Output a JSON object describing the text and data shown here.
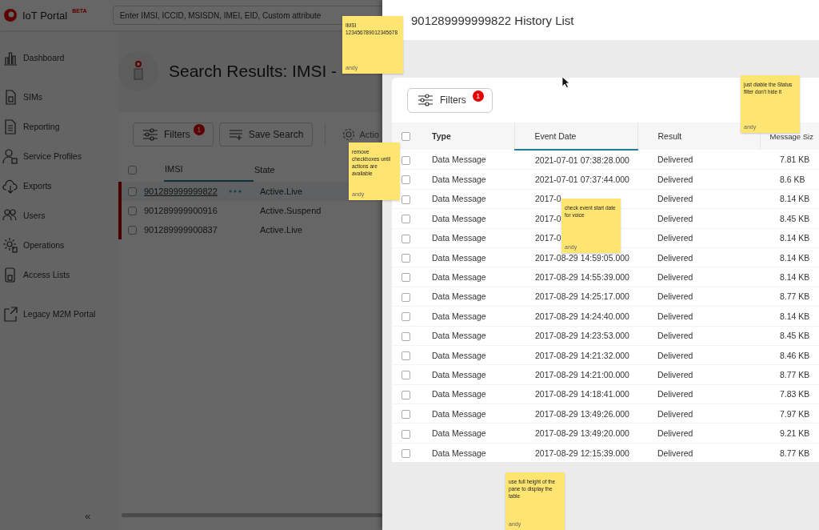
{
  "header": {
    "logo": "IoT Portal",
    "badge": "BETA",
    "search_placeholder": "Enter IMSI, ICCID, MSISDN, IMEI, EID, Custom attribute"
  },
  "sidebar": {
    "items": [
      {
        "label": "Dashboard",
        "kind": "chart"
      },
      {
        "label": "SIMs",
        "kind": "sim"
      },
      {
        "label": "Reporting",
        "kind": "doc"
      },
      {
        "label": "Service Profiles",
        "kind": "person"
      },
      {
        "label": "Exports",
        "kind": "cloud"
      },
      {
        "label": "Users",
        "kind": "users"
      },
      {
        "label": "Operations",
        "kind": "gear"
      },
      {
        "label": "Access Lists",
        "kind": "card"
      }
    ],
    "links": [
      {
        "label": "Legacy M2M Portal",
        "kind": "external"
      }
    ],
    "collapse": "«"
  },
  "page": {
    "title": "Search Results: IMSI -",
    "toolbar": {
      "filters": "Filters",
      "filter_count": "1",
      "save": "Save Search",
      "actions": "Actio"
    },
    "table": {
      "columns": [
        {
          "label": "IMSI",
          "sorted": true
        },
        {
          "label": "State",
          "sorted": false
        }
      ],
      "select_all": false,
      "rows": [
        {
          "imsi": "901289999999822",
          "state": "Active.Live",
          "selected": true,
          "checked": false
        },
        {
          "imsi": "901289999900916",
          "state": "Active.Suspend",
          "selected": false,
          "checked": false
        },
        {
          "imsi": "901289999900837",
          "state": "Active.Live",
          "selected": false,
          "checked": false
        }
      ]
    }
  },
  "drawer": {
    "title": "901289999999822 History List",
    "filters": "Filters",
    "filter_count": "1",
    "select_all": false,
    "columns": [
      {
        "label": "Type",
        "sorted": false
      },
      {
        "label": "Event Date",
        "sorted": true
      },
      {
        "label": "Result",
        "sorted": false
      },
      {
        "label": "Message Siz",
        "sorted": false
      }
    ],
    "rows": [
      {
        "type": "Data Message",
        "date": "2021-07-01 07:38:28.000",
        "result": "Delivered",
        "size": "7.81 KB",
        "checked": false
      },
      {
        "type": "Data Message",
        "date": "2021-07-01 07:37:44.000",
        "result": "Delivered",
        "size": "8.6 KB",
        "checked": false
      },
      {
        "type": "Data Message",
        "date": "2017-0",
        "result": "Delivered",
        "size": "8.14 KB",
        "checked": false
      },
      {
        "type": "Data Message",
        "date": "2017-0",
        "result": "Delivered",
        "size": "8.45 KB",
        "checked": false
      },
      {
        "type": "Data Message",
        "date": "2017-0",
        "result": "Delivered",
        "size": "8.14 KB",
        "checked": false
      },
      {
        "type": "Data Message",
        "date": "2017-08-29 14:59:05.000",
        "result": "Delivered",
        "size": "8.14 KB",
        "checked": false
      },
      {
        "type": "Data Message",
        "date": "2017-08-29 14:55:39.000",
        "result": "Delivered",
        "size": "8.14 KB",
        "checked": false
      },
      {
        "type": "Data Message",
        "date": "2017-08-29 14:25:17.000",
        "result": "Delivered",
        "size": "8.77 KB",
        "checked": false
      },
      {
        "type": "Data Message",
        "date": "2017-08-29 14:24:40.000",
        "result": "Delivered",
        "size": "8.14 KB",
        "checked": false
      },
      {
        "type": "Data Message",
        "date": "2017-08-29 14:23:53.000",
        "result": "Delivered",
        "size": "8.45 KB",
        "checked": false
      },
      {
        "type": "Data Message",
        "date": "2017-08-29 14:21:32.000",
        "result": "Delivered",
        "size": "8.46 KB",
        "checked": false
      },
      {
        "type": "Data Message",
        "date": "2017-08-29 14:21:00.000",
        "result": "Delivered",
        "size": "8.77 KB",
        "checked": false
      },
      {
        "type": "Data Message",
        "date": "2017-08-29 14:18:41.000",
        "result": "Delivered",
        "size": "7.83 KB",
        "checked": false
      },
      {
        "type": "Data Message",
        "date": "2017-08-29 13:49:26.000",
        "result": "Delivered",
        "size": "7.97 KB",
        "checked": false
      },
      {
        "type": "Data Message",
        "date": "2017-08-29 13:49:20.000",
        "result": "Delivered",
        "size": "9.21 KB",
        "checked": false
      },
      {
        "type": "Data Message",
        "date": "2017-08-29 12:15:39.000",
        "result": "Delivered",
        "size": "8.77 KB",
        "checked": false
      }
    ]
  },
  "notes": [
    {
      "text": "IMSI 123456789012345678",
      "author": "andy"
    },
    {
      "text": "remove checkboxes until actions are available",
      "author": "andy"
    },
    {
      "text": "just diable the Status filter don't hide it",
      "author": "andy"
    },
    {
      "text": "check event start date for voice",
      "author": "andy"
    },
    {
      "text": "use full height of the pane to display the table",
      "author": "andy"
    }
  ]
}
